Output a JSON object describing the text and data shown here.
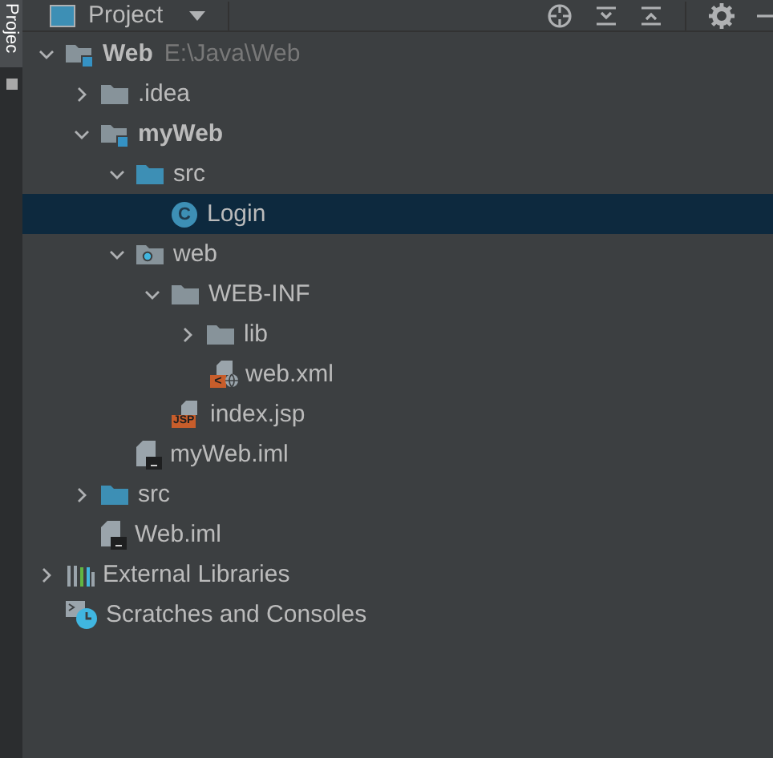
{
  "side_tab": {
    "label": "Projec",
    "selected": true
  },
  "header": {
    "title": "Project"
  },
  "tree": [
    {
      "label": "Web",
      "hint": "E:\\Java\\Web",
      "kind": "module",
      "bold": true,
      "expanded": true,
      "selected": false,
      "children": [
        {
          "label": ".idea",
          "kind": "folder",
          "bold": false,
          "expanded": false,
          "selected": false
        },
        {
          "label": "myWeb",
          "kind": "module",
          "bold": true,
          "expanded": true,
          "selected": false,
          "children": [
            {
              "label": "src",
              "kind": "source",
              "bold": false,
              "expanded": true,
              "selected": false,
              "children": [
                {
                  "label": "Login",
                  "kind": "class",
                  "icon_text": "C",
                  "bold": false,
                  "selected": true
                }
              ]
            },
            {
              "label": "web",
              "kind": "web",
              "bold": false,
              "expanded": true,
              "selected": false,
              "children": [
                {
                  "label": "WEB-INF",
                  "kind": "folder",
                  "bold": false,
                  "expanded": true,
                  "selected": false,
                  "children": [
                    {
                      "label": "lib",
                      "kind": "folder",
                      "bold": false,
                      "expanded": false,
                      "selected": false
                    },
                    {
                      "label": "web.xml",
                      "kind": "xml",
                      "icon_text": "<",
                      "bold": false,
                      "selected": false
                    }
                  ]
                },
                {
                  "label": "index.jsp",
                  "kind": "jsp",
                  "icon_text": "JSP",
                  "bold": false,
                  "selected": false
                }
              ]
            },
            {
              "label": "myWeb.iml",
              "kind": "iml",
              "bold": false,
              "selected": false
            }
          ]
        },
        {
          "label": "src",
          "kind": "source",
          "bold": false,
          "expanded": false,
          "selected": false
        },
        {
          "label": "Web.iml",
          "kind": "iml",
          "bold": false,
          "selected": false
        }
      ]
    },
    {
      "label": "External Libraries",
      "kind": "libraries",
      "bold": false,
      "expanded": false,
      "selected": false
    },
    {
      "label": "Scratches and Consoles",
      "kind": "scratches",
      "bold": false,
      "selected": false
    }
  ]
}
